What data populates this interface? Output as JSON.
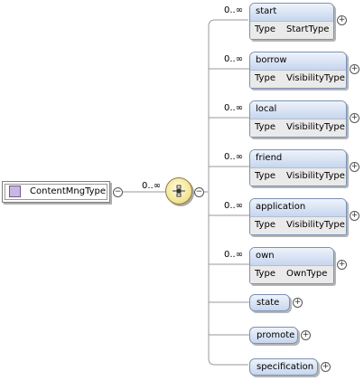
{
  "root": {
    "label": "ContentMngType",
    "icon": "complex-type-icon"
  },
  "root_occurs": "0..∞",
  "compositor": {
    "icon": "sequence-compositor-icon"
  },
  "collapse_symbol": "−",
  "expand_symbol": "+",
  "colors": {
    "element_fill": "#c7d6ee",
    "element_border": "#7a92b5",
    "compositor_fill": "#f3e69a",
    "type_icon": "#c9b6e6"
  },
  "elements": [
    {
      "name": "start",
      "occurs": "0..∞",
      "type_label": "Type",
      "type": "StartType"
    },
    {
      "name": "borrow",
      "occurs": "0..∞",
      "type_label": "Type",
      "type": "VisibilityType"
    },
    {
      "name": "local",
      "occurs": "0..∞",
      "type_label": "Type",
      "type": "VisibilityType"
    },
    {
      "name": "friend",
      "occurs": "0..∞",
      "type_label": "Type",
      "type": "VisibilityType"
    },
    {
      "name": "application",
      "occurs": "0..∞",
      "type_label": "Type",
      "type": "VisibilityType"
    },
    {
      "name": "own",
      "occurs": "0..∞",
      "type_label": "Type",
      "type": "OwnType"
    },
    {
      "name": "state"
    },
    {
      "name": "promote"
    },
    {
      "name": "specification"
    }
  ]
}
